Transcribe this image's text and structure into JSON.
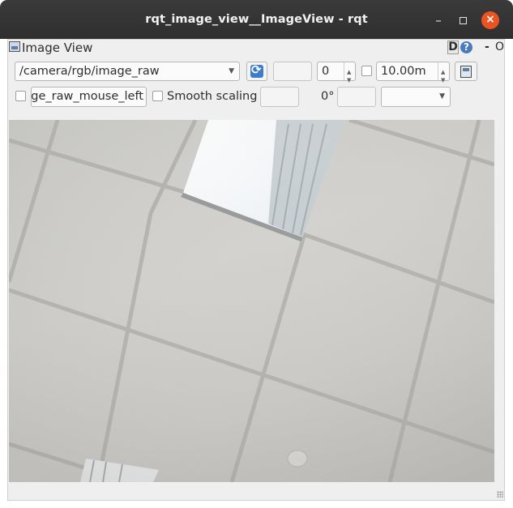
{
  "window": {
    "title": "rqt_image_view__ImageView - rqt",
    "minimize_glyph": "–",
    "close_glyph": "×"
  },
  "plugin": {
    "title": "Image View",
    "icon": "image-view-icon",
    "d_label": "D",
    "help_label": "?",
    "dash_label": "-",
    "o_label": "O"
  },
  "toolbar": {
    "topic": "/camera/rgb/image_raw",
    "refresh_icon": "refresh-icon",
    "offset_value": "0",
    "rate_enabled": false,
    "rate_value": "10.00m",
    "save_icon": "save-icon"
  },
  "options": {
    "mouse_publish_enabled": false,
    "mouse_topic": "image_raw_mouse_left",
    "smooth_scaling_enabled": false,
    "smooth_scaling_label": "Smooth scaling",
    "rotation_label": "0°",
    "rotation_select_value": ""
  },
  "colors": {
    "titlebar": "#2f2f2f",
    "close_button": "#e95420",
    "accent": "#3d7cc9",
    "ceiling": "#cfceca"
  }
}
